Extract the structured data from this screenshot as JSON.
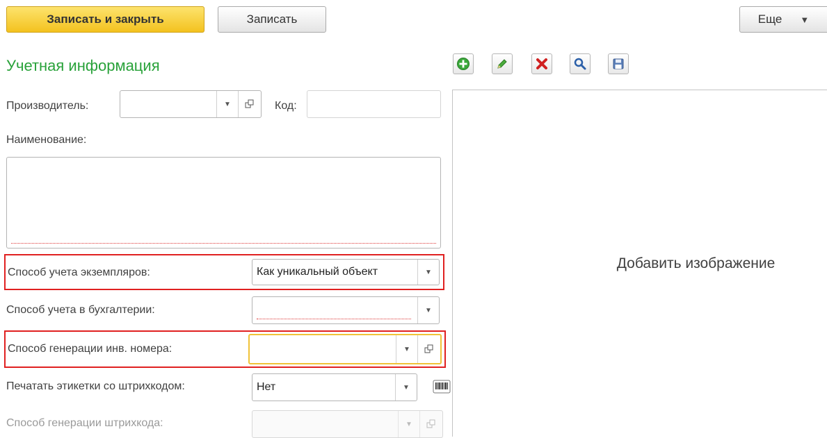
{
  "toolbar": {
    "save_close_label": "Записать и закрыть",
    "save_label": "Записать",
    "more_label": "Еще"
  },
  "section_title": "Учетная информация",
  "image_toolbar": {
    "icons": [
      "add-icon",
      "edit-icon",
      "delete-icon",
      "view-icon",
      "save-icon"
    ]
  },
  "form": {
    "manufacturer": {
      "label": "Производитель:",
      "value": ""
    },
    "code": {
      "label": "Код:",
      "value": ""
    },
    "name": {
      "label": "Наименование:",
      "value": ""
    },
    "instance_accounting": {
      "label": "Способ учета экземпляров:",
      "value": "Как уникальный объект"
    },
    "accounting_method": {
      "label": "Способ учета в бухгалтерии:",
      "value": ""
    },
    "inv_number_generation": {
      "label": "Способ генерации инв. номера:",
      "value": ""
    },
    "print_barcode_labels": {
      "label": "Печатать этикетки со штрихкодом:",
      "value": "Нет"
    },
    "barcode_generation": {
      "label": "Способ генерации штрихкода:",
      "value": ""
    }
  },
  "image_panel": {
    "add_image_label": "Добавить изображение"
  },
  "colors": {
    "primary_button": "#f3c21f",
    "title_green": "#29a23a",
    "highlight_red": "#e02020",
    "focus_yellow": "#f0c238"
  }
}
